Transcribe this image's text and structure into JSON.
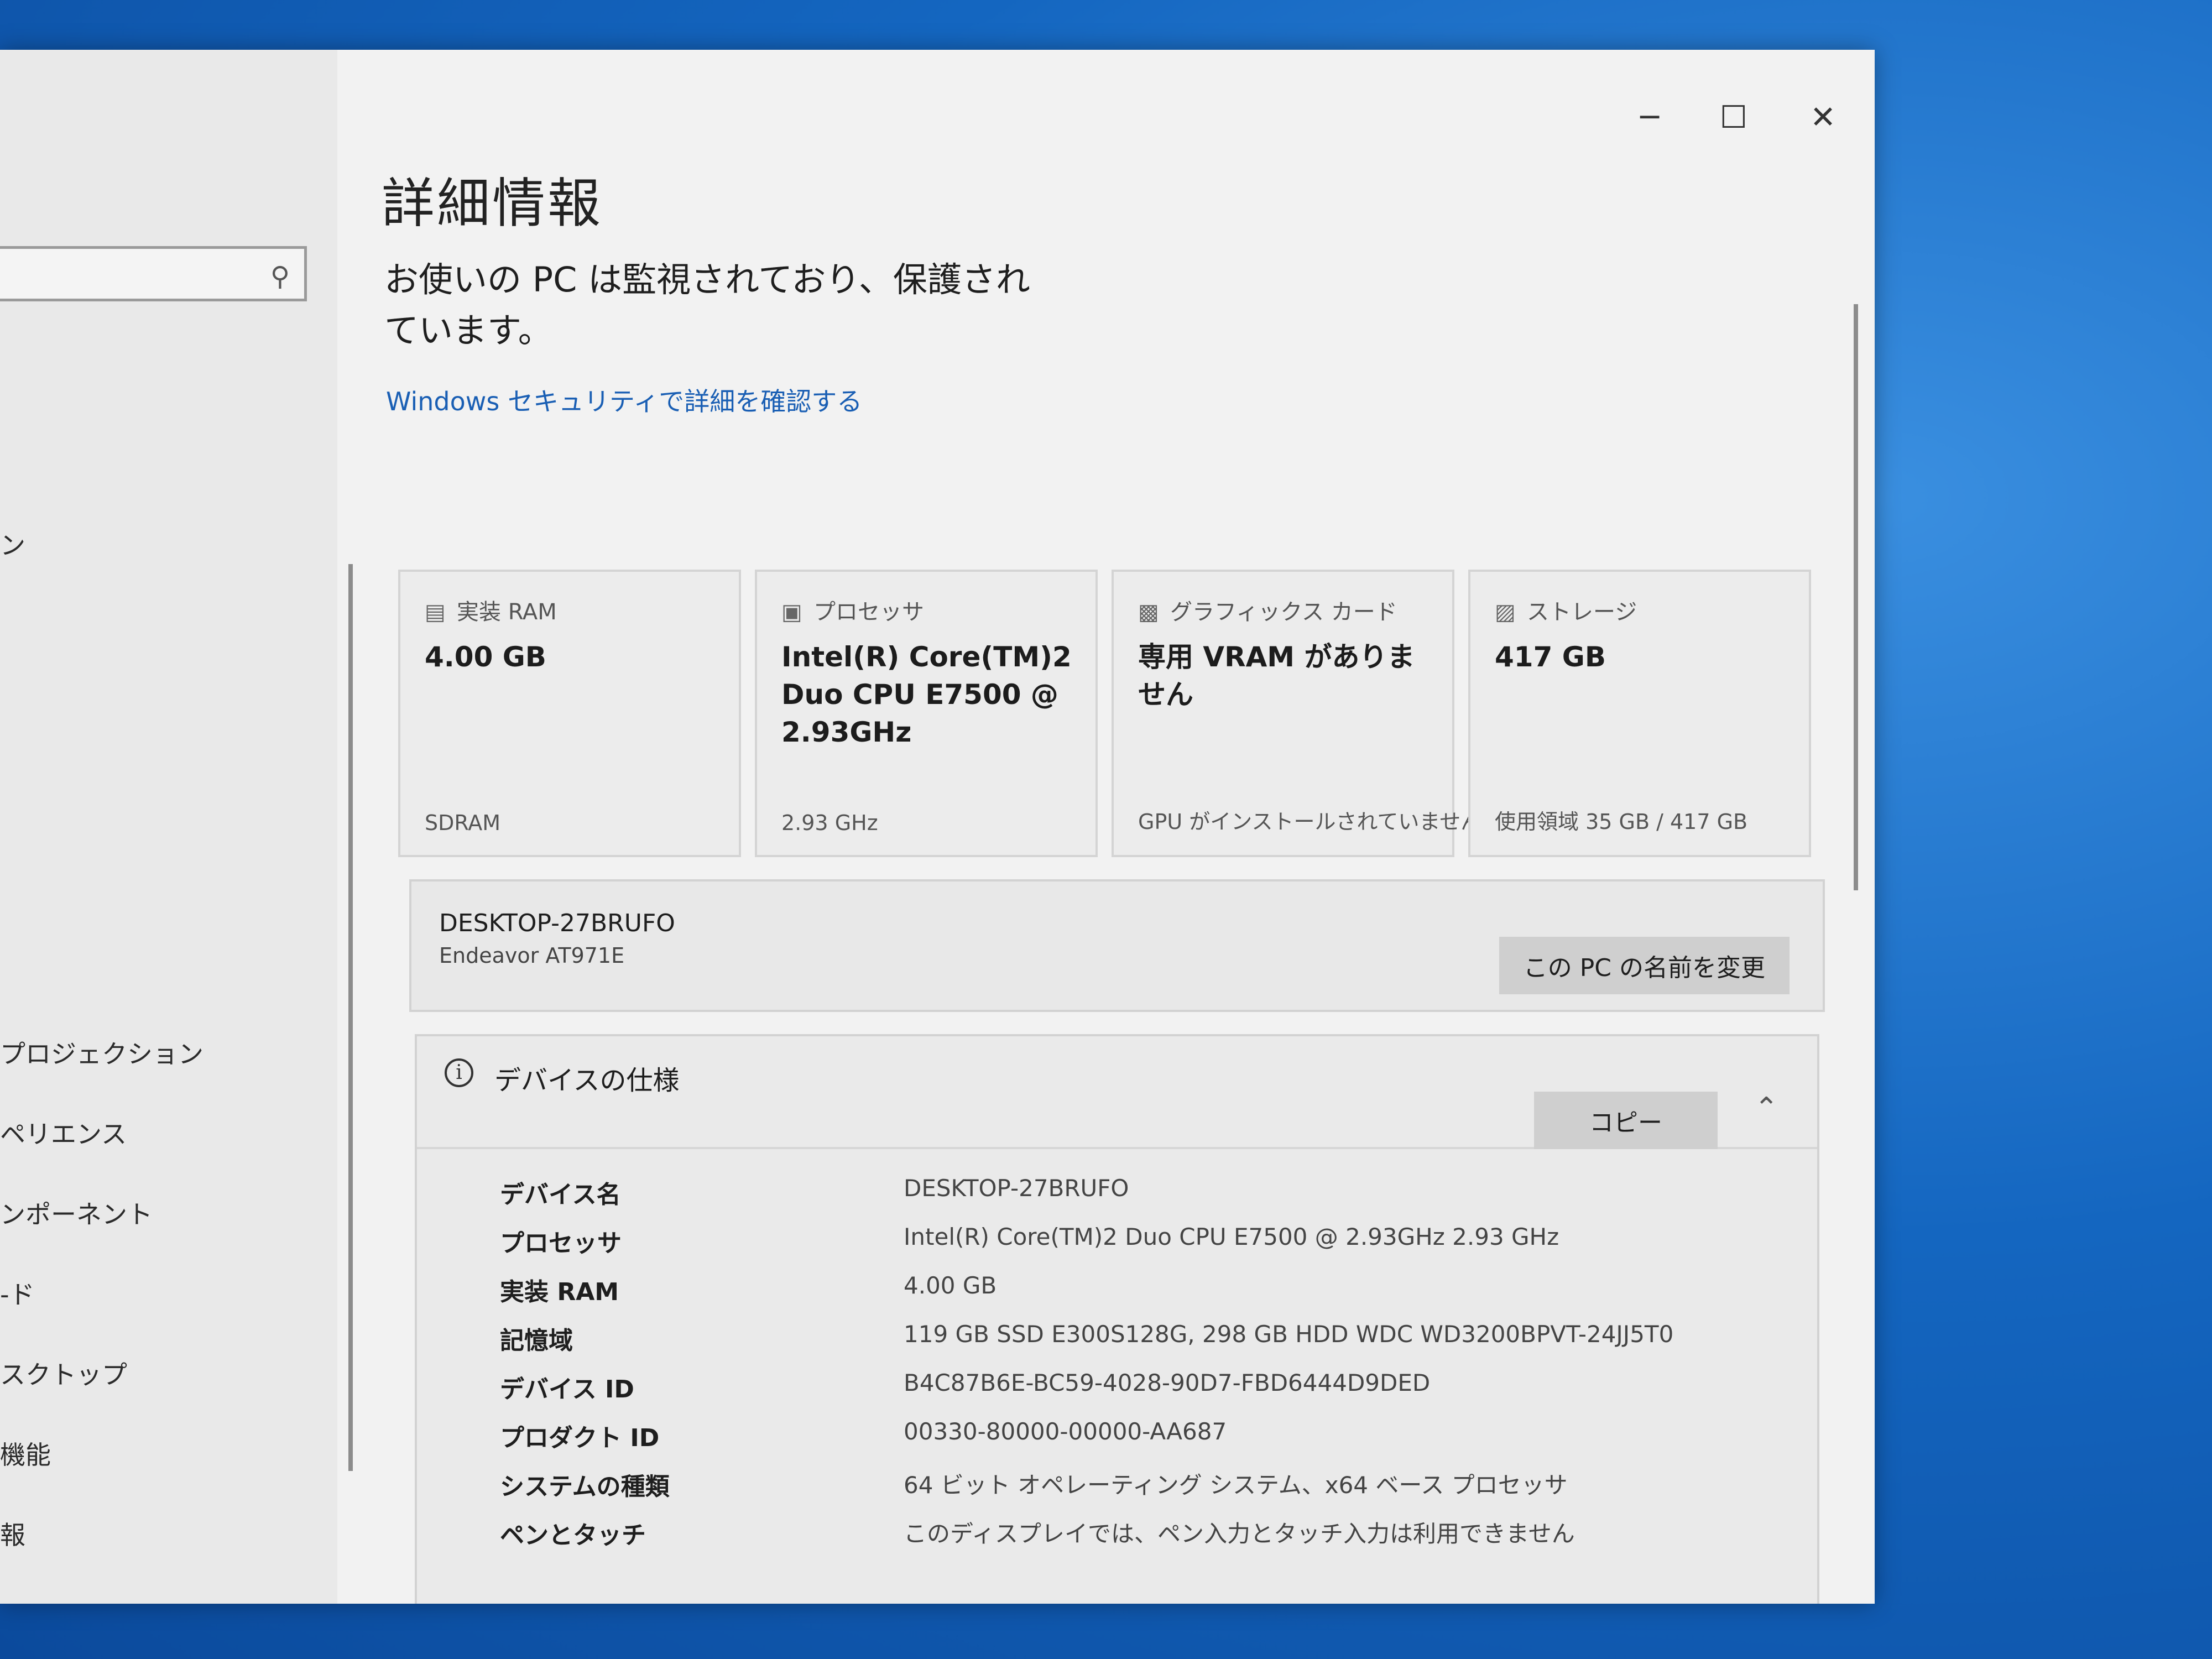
{
  "sidebar": {
    "items": [
      {
        "label": "ン"
      },
      {
        "label": "プロジェクション"
      },
      {
        "label": "ペリエンス"
      },
      {
        "label": "ンポーネント"
      },
      {
        "label": "-ド"
      },
      {
        "label": "スクトップ"
      },
      {
        "label": "機能"
      },
      {
        "label": "報"
      }
    ]
  },
  "window": {
    "minimize": "─",
    "maximize": "☐",
    "close": "✕"
  },
  "main": {
    "title": "詳細情報",
    "status": "お使いの PC は監視されており、保護されています。",
    "security_link": "Windows セキュリティで詳細を確認する"
  },
  "cards": [
    {
      "title": "実装 RAM",
      "value": "4.00 GB",
      "footer": "SDRAM",
      "icon": "ram-icon"
    },
    {
      "title": "プロセッサ",
      "value": "Intel(R) Core(TM)2 Duo CPU E7500 @ 2.93GHz",
      "footer": "2.93 GHz",
      "icon": "processor-icon"
    },
    {
      "title": "グラフィックス カード",
      "value": "専用 VRAM がありません",
      "footer": "GPU がインストールされていません",
      "icon": "graphics-card-icon"
    },
    {
      "title": "ストレージ",
      "value": "417 GB",
      "footer": "使用領域 35 GB / 417 GB",
      "icon": "storage-icon"
    }
  ],
  "device": {
    "name": "DESKTOP-27BRUFO",
    "model": "Endeavor AT971E",
    "rename_label": "この PC の名前を変更"
  },
  "specs": {
    "title": "デバイスの仕様",
    "copy_label": "コピー",
    "rows": [
      {
        "label": "デバイス名",
        "value": "DESKTOP-27BRUFO"
      },
      {
        "label": "プロセッサ",
        "value": "Intel(R) Core(TM)2 Duo CPU     E7500  @ 2.93GHz   2.93 GHz"
      },
      {
        "label": "実装 RAM",
        "value": "4.00 GB"
      },
      {
        "label": "記憶域",
        "value": "119 GB SSD E300S128G, 298 GB HDD WDC WD3200BPVT-24JJ5T0"
      },
      {
        "label": "デバイス ID",
        "value": "B4C87B6E-BC59-4028-90D7-FBD6444D9DED"
      },
      {
        "label": "プロダクト ID",
        "value": "00330-80000-00000-AA687"
      },
      {
        "label": "システムの種類",
        "value": "64 ビット オペレーティング システム、x64 ベース プロセッサ"
      },
      {
        "label": "ペンとタッチ",
        "value": "このディスプレイでは、ペン入力とタッチ入力は利用できません"
      }
    ]
  }
}
